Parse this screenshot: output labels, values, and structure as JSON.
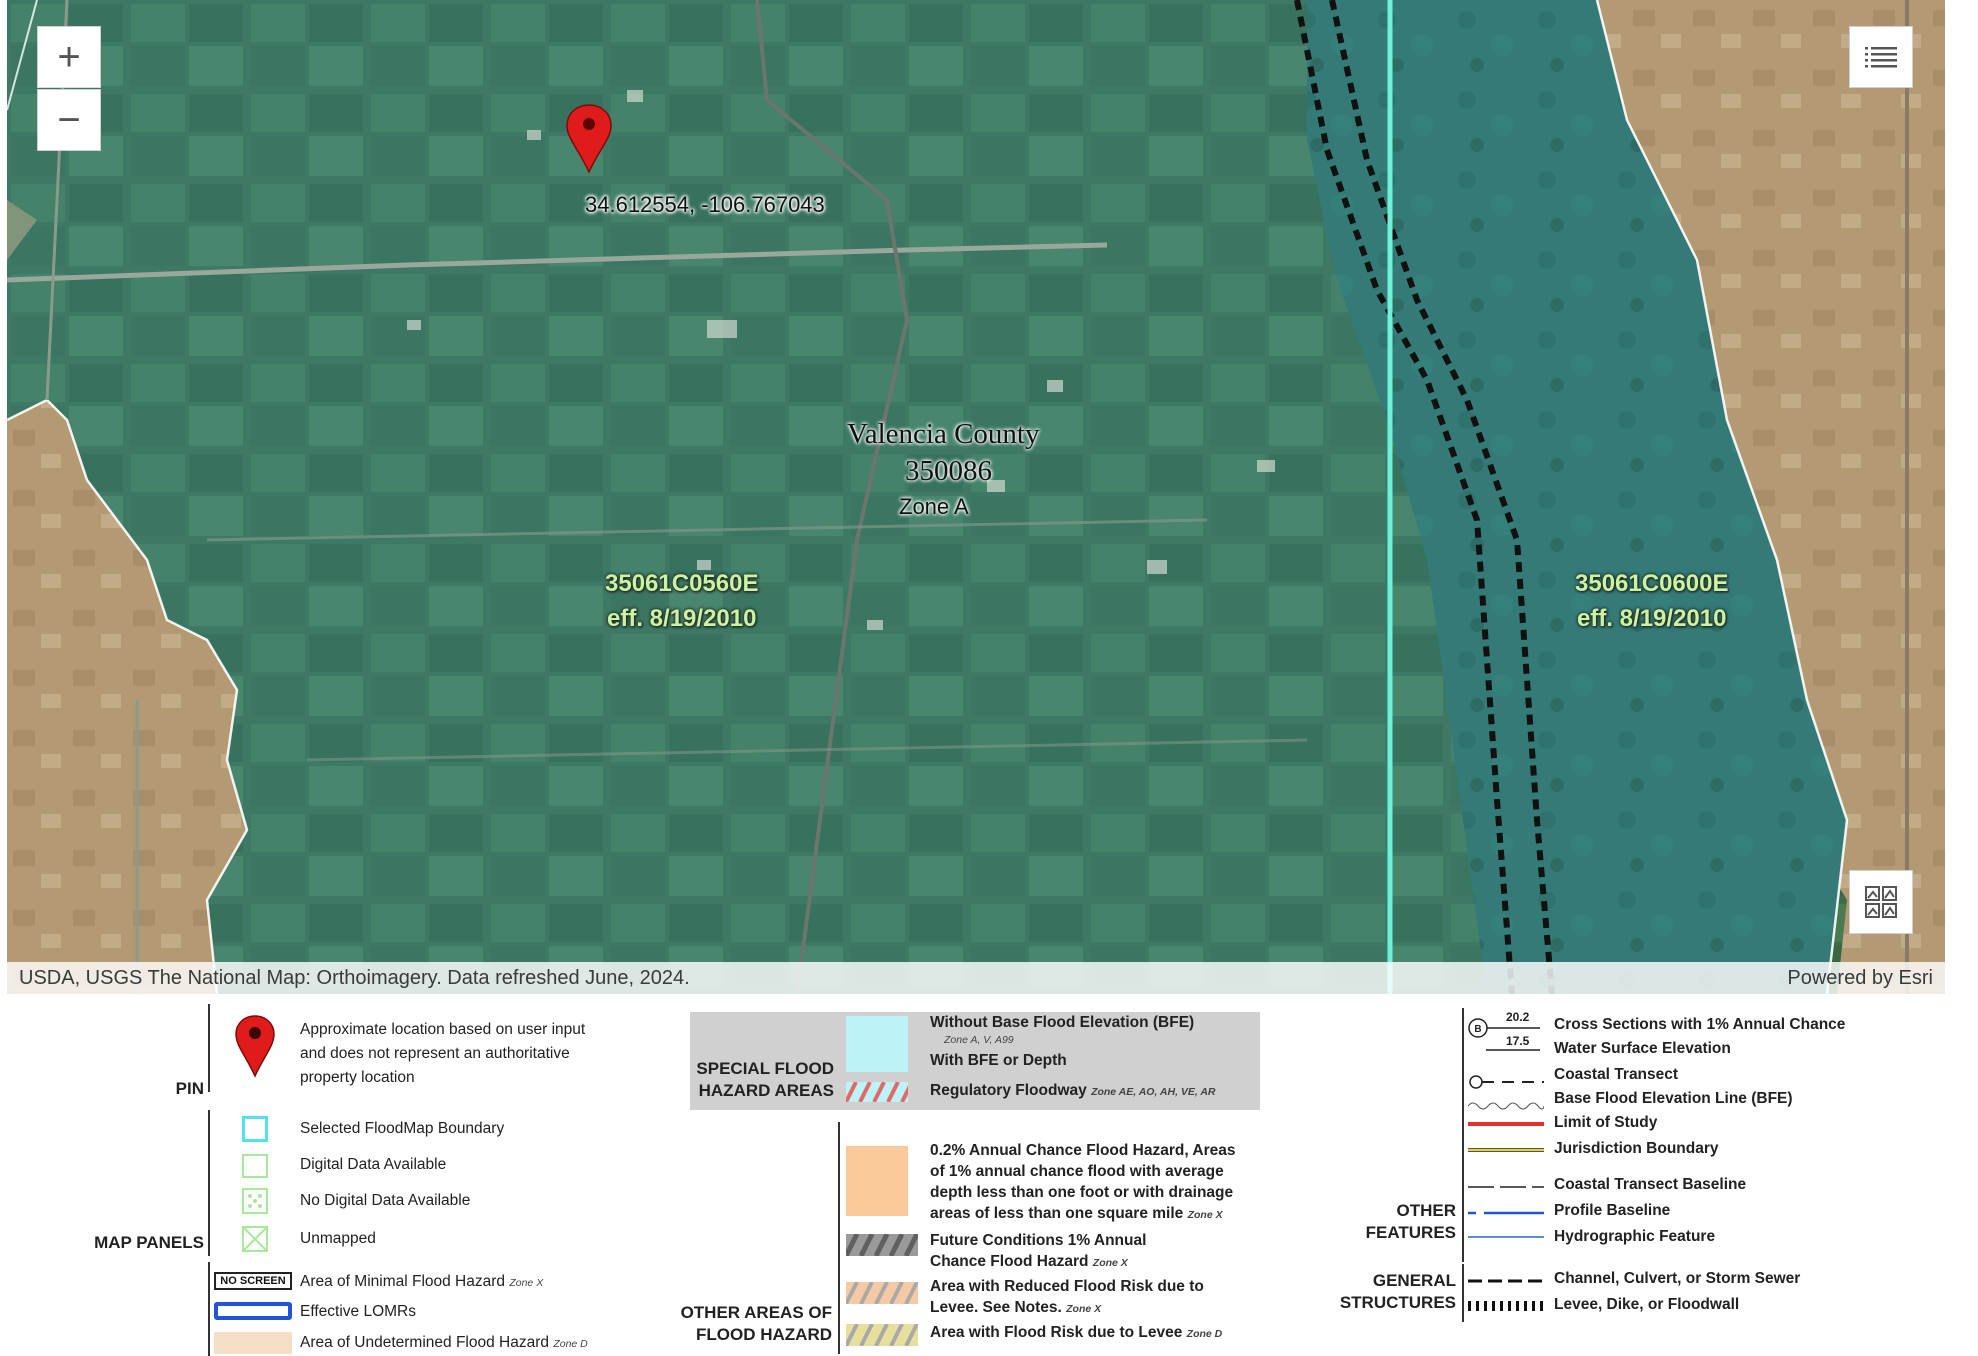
{
  "map": {
    "pin": {
      "coordinates_label": "34.612554, -106.767043"
    },
    "community": {
      "name": "Valencia County",
      "id": "350086",
      "zone": "Zone A"
    },
    "panels": [
      {
        "id": "35061C0560E",
        "effective": "eff. 8/19/2010"
      },
      {
        "id": "35061C0600E",
        "effective": "eff. 8/19/2010"
      }
    ],
    "controls": {
      "zoom_in": "+",
      "zoom_out": "−"
    },
    "attribution_left": "USDA, USGS The National Map: Orthoimagery. Data refreshed June, 2024.",
    "attribution_right": "Powered by Esri",
    "colors": {
      "flood_zone_teal": "#3c8c8a",
      "panel_boundary_cyan": "#6ff0d8",
      "panel_label_green": "#c8f5a0",
      "pin_red": "#e01b1b"
    }
  },
  "legend": {
    "pin": {
      "heading": "PIN",
      "description": [
        "Approximate location based on user input",
        "and does not represent an authoritative",
        "property location"
      ]
    },
    "map_panels": {
      "heading": "MAP PANELS",
      "items": [
        "Selected FloodMap Boundary",
        "Digital Data Available",
        "No Digital Data Available",
        "Unmapped"
      ]
    },
    "other": {
      "no_screen_tag": "NO SCREEN",
      "minimal_hazard": "Area of Minimal Flood Hazard",
      "minimal_hazard_zone": "Zone X",
      "effective_lomrs": "Effective LOMRs",
      "undetermined_hazard": "Area of Undetermined Flood Hazard",
      "undetermined_zone": "Zone D"
    },
    "special_flood": {
      "heading": [
        "SPECIAL FLOOD",
        "HAZARD AREAS"
      ],
      "without_bfe": "Without Base Flood Elevation (BFE)",
      "without_bfe_zones": "Zone A, V, A99",
      "with_bfe": "With BFE or Depth",
      "floodway": "Regulatory Floodway",
      "floodway_zones": "Zone AE, AO, AH, VE, AR"
    },
    "other_areas": {
      "heading": [
        "OTHER AREAS OF",
        "FLOOD HAZARD"
      ],
      "annual_02": [
        "0.2% Annual Chance Flood Hazard, Areas",
        "of 1% annual chance flood with average",
        "depth less than one foot or with drainage",
        "areas of less than one square mile"
      ],
      "annual_02_zone": "Zone X",
      "future": [
        "Future Conditions 1% Annual",
        "Chance Flood Hazard"
      ],
      "future_zone": "Zone X",
      "reduced_risk": [
        "Area with Reduced Flood Risk due to",
        "Levee. See Notes."
      ],
      "reduced_zone": "Zone X",
      "levee_risk": "Area with Flood Risk due to Levee",
      "levee_zone": "Zone D"
    },
    "other_features": {
      "heading": [
        "OTHER",
        "FEATURES"
      ],
      "cs_value_1": "20.2",
      "cs_value_2": "17.5",
      "cross_sections": "Cross Sections with 1% Annual Chance",
      "water_surface": "Water Surface Elevation",
      "coastal_transect": "Coastal Transect",
      "bfe_line": "Base Flood Elevation Line (BFE)",
      "limit_study": "Limit of Study",
      "jurisdiction": "Jurisdiction Boundary",
      "transect_baseline": "Coastal Transect Baseline",
      "profile_baseline": "Profile Baseline",
      "hydrographic": "Hydrographic Feature"
    },
    "general_structures": {
      "heading": [
        "GENERAL",
        "STRUCTURES"
      ],
      "channel": "Channel, Culvert, or Storm Sewer",
      "levee": "Levee, Dike, or Floodwall"
    }
  }
}
